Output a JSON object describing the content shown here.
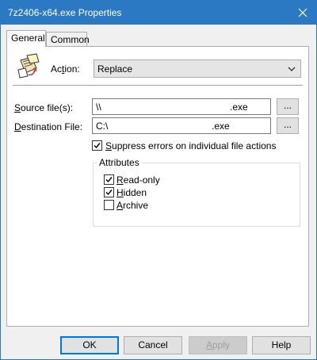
{
  "window": {
    "title": "7z2406-x64.exe Properties"
  },
  "tabs": [
    {
      "label": "General"
    },
    {
      "label": "Common"
    }
  ],
  "action": {
    "label_prefix": "Ac",
    "label_mnemonic": "t",
    "label_suffix": "ion:",
    "value": "Replace"
  },
  "source": {
    "label_mnemonic": "S",
    "label_rest": "ource file(s):",
    "value_prefix": "\\\\",
    "value_suffix": ".exe",
    "browse_label": "..."
  },
  "destination": {
    "label_mnemonic": "D",
    "label_rest": "estination File:",
    "value_prefix": "C:\\",
    "value_suffix": ".exe",
    "browse_label": "..."
  },
  "suppress": {
    "checked": true,
    "label_mnemonic": "S",
    "label_rest": "uppress errors on individual file actions"
  },
  "attributes": {
    "title": "Attributes",
    "items": [
      {
        "checked": true,
        "label_mnemonic": "R",
        "label_rest": "ead-only"
      },
      {
        "checked": true,
        "label_mnemonic": "H",
        "label_rest": "idden"
      },
      {
        "checked": false,
        "label_mnemonic": "A",
        "label_rest": "rchive"
      }
    ]
  },
  "buttons": {
    "ok": "OK",
    "cancel": "Cancel",
    "apply_mnemonic": "A",
    "apply_rest": "pply",
    "help": "Help"
  },
  "colors": {
    "titlebar": "#2b79c2",
    "focus": "#0078d7"
  }
}
